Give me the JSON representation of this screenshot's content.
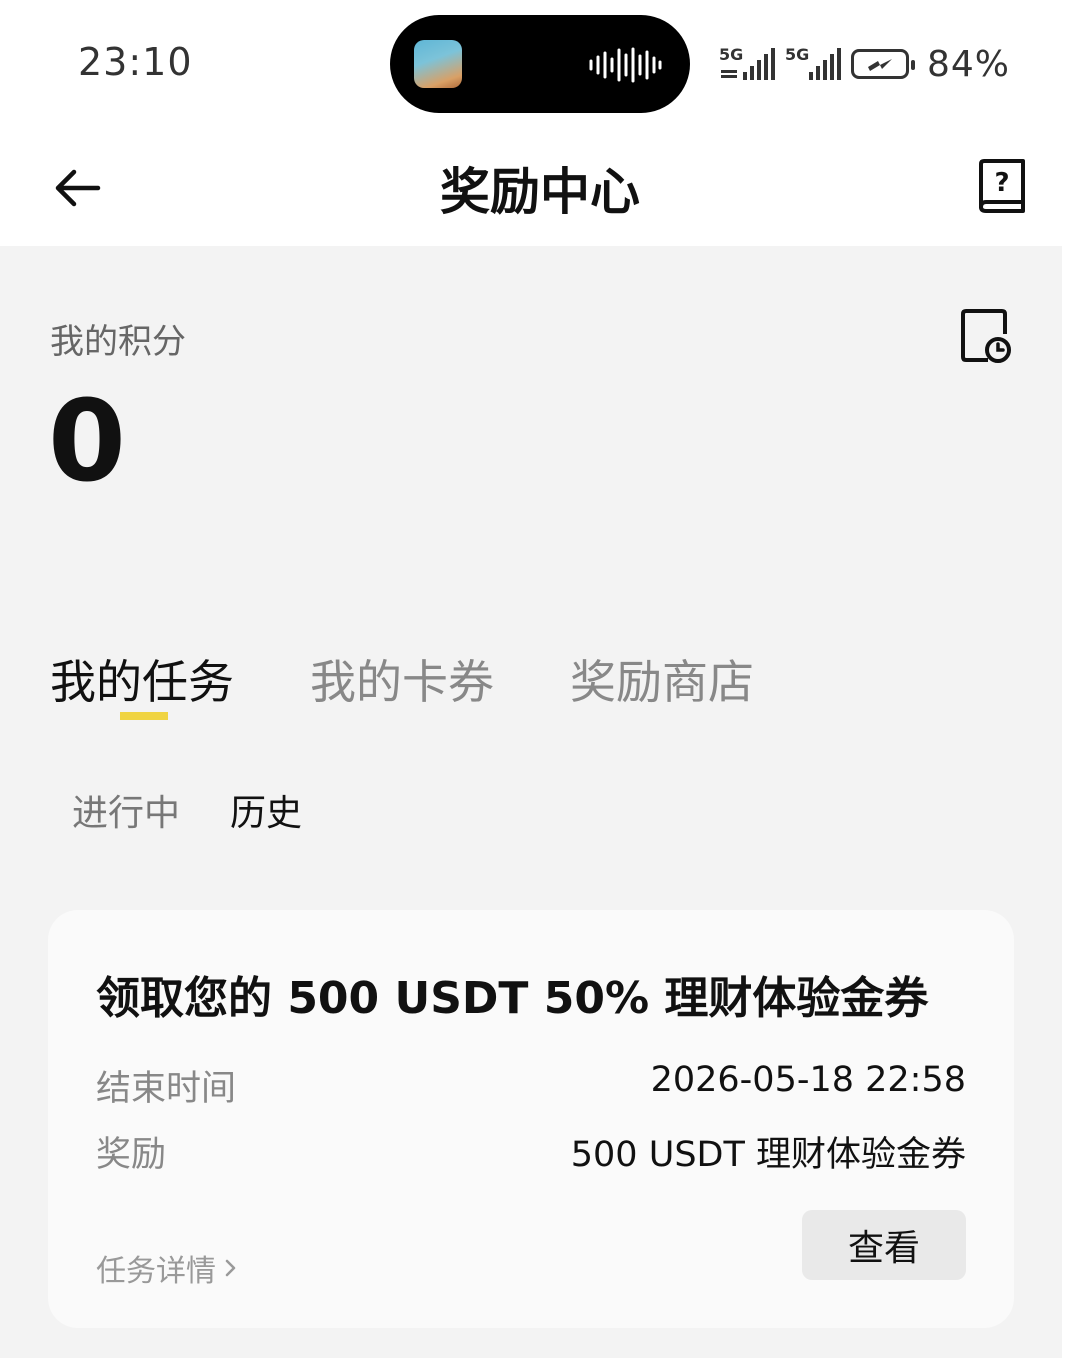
{
  "status_bar": {
    "time": "23:10",
    "network1": "5G",
    "network2": "5G",
    "battery_pct": "84%",
    "battery_level": 0.84
  },
  "header": {
    "title": "奖励中心"
  },
  "points": {
    "label": "我的积分",
    "value": "0"
  },
  "tabs": [
    {
      "label": "我的任务",
      "active": true
    },
    {
      "label": "我的卡券",
      "active": false
    },
    {
      "label": "奖励商店",
      "active": false
    }
  ],
  "subtabs": [
    {
      "label": "进行中",
      "active": false
    },
    {
      "label": "历史",
      "active": true
    }
  ],
  "task_card": {
    "title": "领取您的 500 USDT 50% 理财体验金券",
    "end_time_label": "结束时间",
    "end_time_value": "2026-05-18 22:58",
    "reward_label": "奖励",
    "reward_value": "500 USDT 理财体验金券",
    "detail_link": "任务详情",
    "view_button": "查看"
  },
  "colors": {
    "accent_indicator": "#f0d442",
    "page_bg": "#f3f3f3",
    "card_bg": "#fafafa"
  }
}
